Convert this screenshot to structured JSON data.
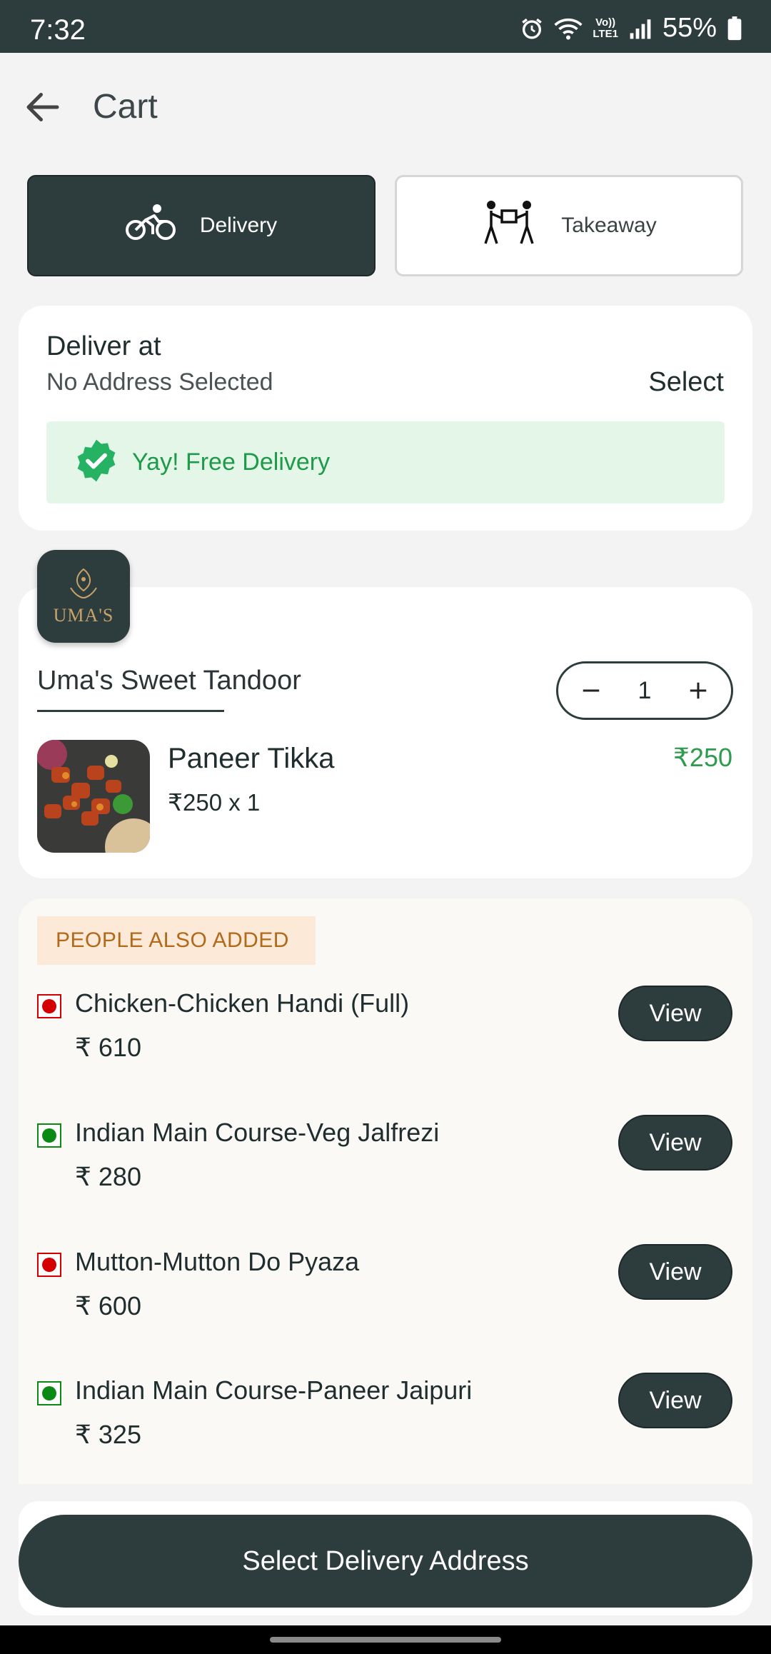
{
  "status_bar": {
    "time": "7:32",
    "lte_line1": "Vo))",
    "lte_line2": "LTE1",
    "battery": "55%"
  },
  "header": {
    "title": "Cart"
  },
  "mode": {
    "delivery_label": "Delivery",
    "takeaway_label": "Takeaway",
    "selected": "Delivery"
  },
  "address": {
    "label": "Deliver at",
    "value": "No Address Selected",
    "select_label": "Select",
    "free_delivery_text": "Yay! Free Delivery"
  },
  "restaurant": {
    "logo_text": "UMA'S",
    "name": "Uma's Sweet Tandoor",
    "quantity": "1",
    "item": {
      "name": "Paneer Tikka",
      "unit_price": "₹250 x 1",
      "total": "₹250"
    }
  },
  "upsell": {
    "heading": "PEOPLE ALSO ADDED",
    "view_label": "View",
    "items": [
      {
        "name": "Chicken-Chicken Handi (Full)",
        "price": "₹ 610",
        "type": "non-veg"
      },
      {
        "name": "Indian Main Course-Veg Jalfrezi",
        "price": "₹ 280",
        "type": "veg"
      },
      {
        "name": "Mutton-Mutton Do Pyaza",
        "price": "₹ 600",
        "type": "non-veg"
      },
      {
        "name": "Indian Main Course-Paneer Jaipuri",
        "price": "₹ 325",
        "type": "veg"
      }
    ]
  },
  "cta": {
    "label": "Select Delivery Address"
  },
  "colors": {
    "primary": "#2d3c3c",
    "green": "#1f9a4a",
    "nonveg": "#d40000",
    "veg": "#0a8a14",
    "badge_bg": "#fde9d8"
  },
  "icons": [
    "alarm-icon",
    "wifi-icon",
    "signal-icon",
    "battery-icon",
    "back-arrow-icon",
    "bicycle-icon",
    "takeaway-people-icon",
    "verified-badge-icon",
    "minus-icon",
    "plus-icon"
  ]
}
